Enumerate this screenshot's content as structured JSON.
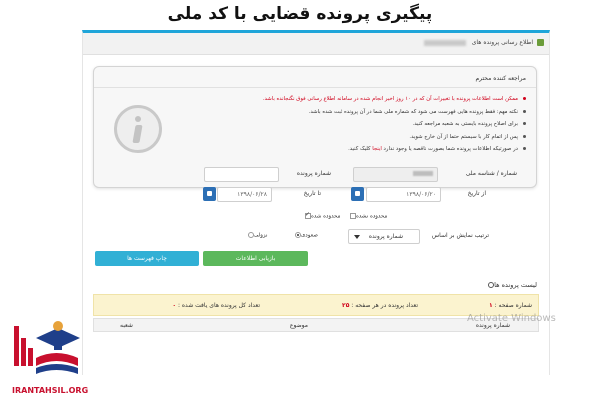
{
  "caption": "پیگیری پرونده قضایی با کد ملی",
  "breadcrumb": {
    "label": "اطلاع رسانی پرونده های"
  },
  "guide": {
    "title": "مراجعه کننده محترم",
    "notes": [
      {
        "text": "ممکن است اطلاعات پرونده با تغییرات آن که در ۱۰ روز اخیر انجام شده در سامانه اطلاع رسانی فوق نگنجانده باشد.",
        "red": true
      },
      {
        "text": "نکته مهم: فقط پرونده هایی فهرست می شود که شماره ملی شما در آن پرونده ثبت شده باشد.",
        "red": false
      },
      {
        "text": "برای اصلاح پرونده بایستی به شعبه مراجعه کنید.",
        "red": false
      },
      {
        "text": "پس از اتمام کار با سیستم حتما از آن خارج شوید.",
        "red": false
      },
      {
        "text": "در صورتیکه اطلاعات پرونده شما بصورت ناقصه یا وجود ندارد",
        "highlight": "اینجا",
        "tail": "کلیک کنید.",
        "red": false
      }
    ]
  },
  "form": {
    "national_id_label": "شماره / شناسه ملی",
    "case_no_label": "شماره پرونده",
    "from_date_label": "از تاریخ",
    "from_date_value": "۱۳۹۸/۰۶/۲۰",
    "to_date_label": "تا تاریخ",
    "to_date_value": "۱۳۹۸/۰۶/۲۸",
    "viewed_label": "محدوده شده",
    "unviewed_label": "محدوده نشده",
    "sort_label": "ترتیب نمایش بر اساس",
    "sort_value": "شماره پرونده",
    "asc_label": "صعودی",
    "desc_label": "نزولی",
    "search_button": "بازیابی اطلاعات",
    "print_button": "چاپ فهرست ها"
  },
  "list": {
    "title": "لیست پرونده ها",
    "page_label": "شماره صفحه :",
    "page_value": "۱",
    "per_page_label": "تعداد پرونده در هر صفحه :",
    "per_page_value": "۲۵",
    "total_label": "تعداد کل پرونده های یافت شده :",
    "total_value": "۰",
    "columns": [
      "شماره پرونده",
      "موضوع",
      "شعبه"
    ]
  },
  "watermark": "Activate Windows",
  "logo": {
    "site": "IRANTAHSIL.ORG"
  },
  "colors": {
    "frame_accent": "#1fa5d9",
    "search_button": "#5cb85c",
    "print_button": "#31b0d5",
    "calendar_button": "#2c6fb5",
    "warning_red": "#d0021b"
  }
}
